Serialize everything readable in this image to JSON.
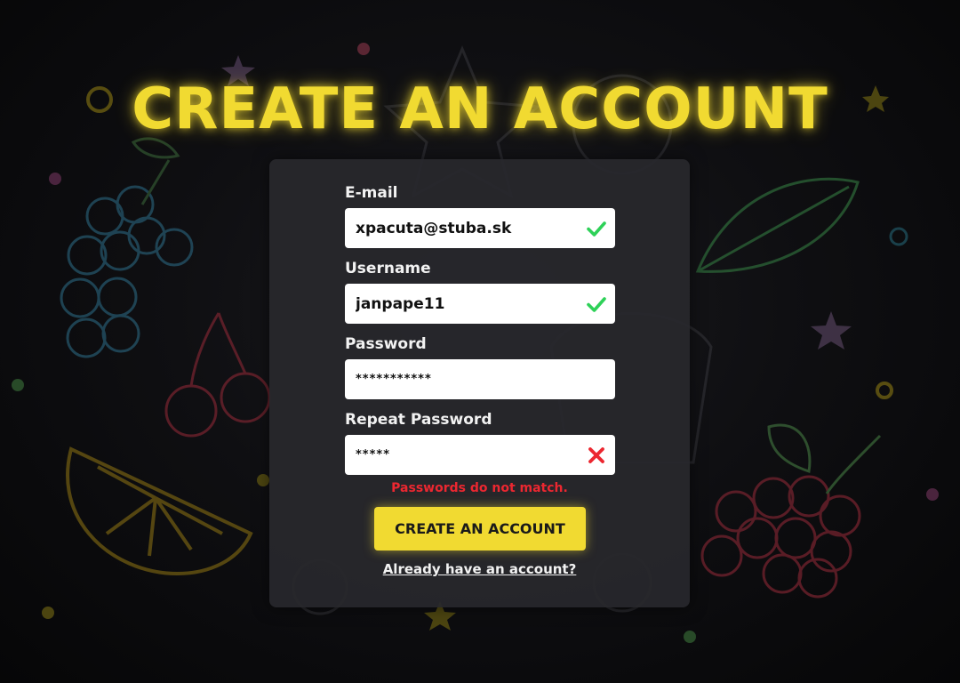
{
  "page": {
    "title": "CREATE AN ACCOUNT"
  },
  "form": {
    "email": {
      "label": "E-mail",
      "value": "xpacuta@stuba.sk",
      "status": "valid"
    },
    "username": {
      "label": "Username",
      "value": "janpape11",
      "status": "valid"
    },
    "password": {
      "label": "Password",
      "value": "***********"
    },
    "repeat_password": {
      "label": "Repeat Password",
      "value": "*****",
      "status": "invalid"
    },
    "error_message": "Passwords do not match.",
    "submit_label": "CREATE AN ACCOUNT",
    "login_link": "Already have an account?"
  },
  "icons": {
    "valid": "check-icon",
    "invalid": "x-icon"
  },
  "colors": {
    "accent": "#f1da31",
    "valid": "#2ed158",
    "error": "#ec2730",
    "card": "#28282c"
  }
}
